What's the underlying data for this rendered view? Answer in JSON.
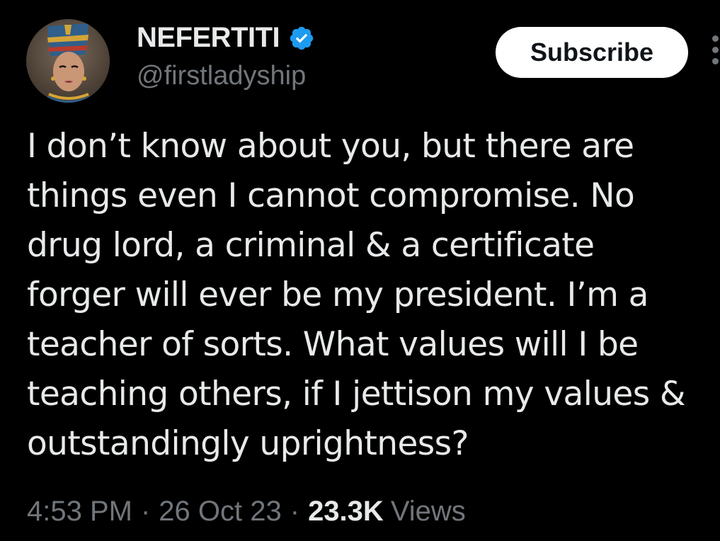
{
  "author": {
    "display_name": "NEFERTITI",
    "handle": "@firstladyship",
    "verified": true,
    "avatar_icon": "nefertiti-avatar"
  },
  "actions": {
    "subscribe_label": "Subscribe",
    "more_icon": "more-dots-icon"
  },
  "tweet": {
    "lines": [
      "I don’t know about you, but there are",
      "things even I cannot compromise. No",
      "drug lord, a criminal & a certificate",
      "forger will ever be my president. I’m a",
      "teacher of sorts. What values will I be",
      "teaching others, if I jettison my values &",
      "outstandingly uprightness?"
    ]
  },
  "meta": {
    "time": "4:53 PM",
    "separator": "·",
    "date": "26 Oct 23",
    "views_count": "23.3K",
    "views_label": "Views"
  },
  "colors": {
    "background": "#000000",
    "primary_text": "#e7e9ea",
    "secondary_text": "#71767b",
    "verified_blue": "#1d9bf0",
    "button_bg": "#ffffff",
    "button_text": "#0f1419"
  }
}
